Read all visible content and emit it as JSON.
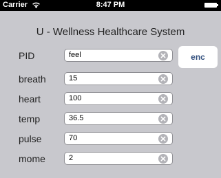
{
  "status_bar": {
    "carrier": "Carrier",
    "time": "8:47 PM",
    "wifi_icon": "wifi-icon",
    "battery_icon": "battery-icon"
  },
  "app": {
    "title": "U - Wellness Healthcare System"
  },
  "form": {
    "fields": [
      {
        "label": "PID",
        "value": "feel"
      },
      {
        "label": "breath",
        "value": "15"
      },
      {
        "label": "heart",
        "value": "100"
      },
      {
        "label": "temp",
        "value": "36.5"
      },
      {
        "label": "pulse",
        "value": "70"
      },
      {
        "label": "mome",
        "value": "2"
      }
    ],
    "clear_icon": "clear-circle-x-icon",
    "enc_label": "enc"
  },
  "colors": {
    "background": "#c8c8cd",
    "status_bar": "#000000",
    "enc_text": "#34517f",
    "field_border": "#8e8e93"
  }
}
